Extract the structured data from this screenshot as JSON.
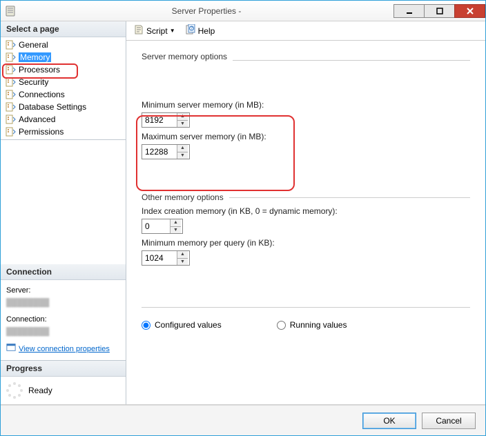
{
  "window": {
    "title": "Server Properties -"
  },
  "titlebtns": {
    "min": "minimize",
    "max": "maximize",
    "close": "close"
  },
  "sidebar": {
    "select_page": "Select a page",
    "pages": [
      {
        "label": "General"
      },
      {
        "label": "Memory",
        "selected": true
      },
      {
        "label": "Processors"
      },
      {
        "label": "Security"
      },
      {
        "label": "Connections"
      },
      {
        "label": "Database Settings"
      },
      {
        "label": "Advanced"
      },
      {
        "label": "Permissions"
      }
    ],
    "connection_head": "Connection",
    "server_label": "Server:",
    "connection_label": "Connection:",
    "view_conn_link": "View connection properties",
    "progress_head": "Progress",
    "ready": "Ready"
  },
  "toolbar": {
    "script": "Script",
    "help": "Help"
  },
  "content": {
    "server_mem_header": "Server memory options",
    "min_mem_label": "Minimum server memory (in MB):",
    "min_mem_value": "8192",
    "max_mem_label": "Maximum server memory (in MB):",
    "max_mem_value": "12288",
    "other_header": "Other memory options",
    "index_label": "Index creation memory (in KB, 0 = dynamic memory):",
    "index_value": "0",
    "min_query_label": "Minimum memory per query (in KB):",
    "min_query_value": "1024",
    "configured_label": "Configured values",
    "running_label": "Running values"
  },
  "footer": {
    "ok": "OK",
    "cancel": "Cancel"
  }
}
